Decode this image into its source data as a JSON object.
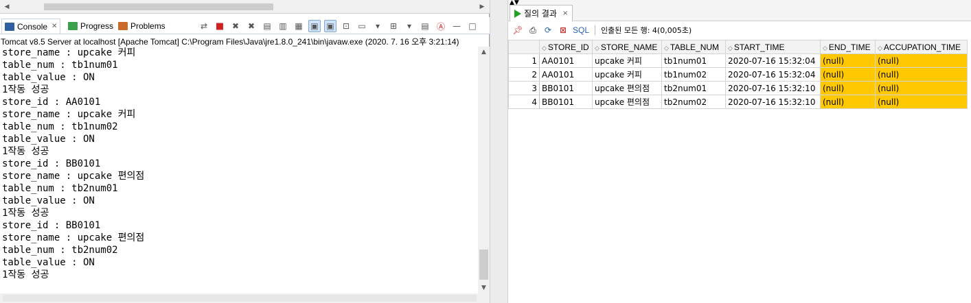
{
  "left_panel": {
    "tabs": [
      {
        "label": "Console",
        "close": "✕"
      },
      {
        "label": "Progress"
      },
      {
        "label": "Problems"
      }
    ],
    "server_line": "Tomcat v8.5 Server at localhost [Apache Tomcat] C:\\Program Files\\Java\\jre1.8.0_241\\bin\\javaw.exe  (2020. 7. 16 오후 3:21:14)",
    "console_lines": [
      "store_name : upcake 커피",
      "table_num : tb1num01",
      "table_value : ON",
      "1작동 성공",
      "store_id : AA0101",
      "store_name : upcake 커피",
      "table_num : tb1num02",
      "table_value : ON",
      "1작동 성공",
      "store_id : BB0101",
      "store_name : upcake 편의점",
      "table_num : tb2num01",
      "table_value : ON",
      "1작동 성공",
      "store_id : BB0101",
      "store_name : upcake 편의점",
      "table_num : tb2num02",
      "table_value : ON",
      "1작동 성공"
    ]
  },
  "right_panel": {
    "tab_label": "질의 결과",
    "tab_close": "×",
    "toolbar": {
      "sql_label": "SQL",
      "rows_text": "인출된 모든 행: 4(0,005초)"
    },
    "columns": [
      "STORE_ID",
      "STORE_NAME",
      "TABLE_NUM",
      "START_TIME",
      "END_TIME",
      "ACCUPATION_TIME"
    ],
    "rows": [
      {
        "n": "1",
        "store_id": "AA0101",
        "store_name": "upcake 커피",
        "table_num": "tb1num01",
        "start_time": "2020-07-16 15:32:04",
        "end_time": "(null)",
        "accupation_time": "(null)"
      },
      {
        "n": "2",
        "store_id": "AA0101",
        "store_name": "upcake 커피",
        "table_num": "tb1num02",
        "start_time": "2020-07-16 15:32:04",
        "end_time": "(null)",
        "accupation_time": "(null)"
      },
      {
        "n": "3",
        "store_id": "BB0101",
        "store_name": "upcake 편의점",
        "table_num": "tb2num01",
        "start_time": "2020-07-16 15:32:10",
        "end_time": "(null)",
        "accupation_time": "(null)"
      },
      {
        "n": "4",
        "store_id": "BB0101",
        "store_name": "upcake 편의점",
        "table_num": "tb2num02",
        "start_time": "2020-07-16 15:32:10",
        "end_time": "(null)",
        "accupation_time": "(null)"
      }
    ]
  },
  "colors": {
    "null_highlight": "#ffc800",
    "selected_tool": "#cfe3fb",
    "play_icon": "#22a022",
    "sql_link": "#2a62b0"
  },
  "icons": {
    "console_tab": "console-icon",
    "progress_tab": "progress-icon",
    "problems_tab": "problems-icon",
    "run_result": "run-triangle-icon",
    "pin": "pin-icon",
    "print": "print-icon",
    "refresh": "refresh-icon",
    "export": "export-icon"
  }
}
